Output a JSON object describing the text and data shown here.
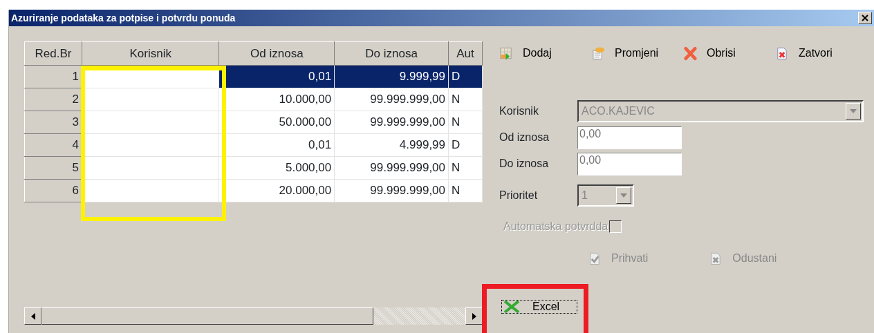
{
  "window": {
    "title": "Azuriranje podataka za potpise i potvrdu  ponuda"
  },
  "table": {
    "columns": [
      "Red.Br",
      "Korisnik",
      "Od iznosa",
      "Do iznosa",
      "Aut"
    ],
    "rows": [
      {
        "cells": [
          "1",
          "",
          "0,01",
          "9.999,99",
          "D"
        ],
        "selected": true
      },
      {
        "cells": [
          "2",
          "",
          "10.000,00",
          "99.999.999,00",
          "N"
        ],
        "selected": false
      },
      {
        "cells": [
          "3",
          "",
          "50.000,00",
          "99.999.999,00",
          "N"
        ],
        "selected": false
      },
      {
        "cells": [
          "4",
          "",
          "0,01",
          "4.999,99",
          "D"
        ],
        "selected": false
      },
      {
        "cells": [
          "5",
          "",
          "5.000,00",
          "99.999.999,00",
          "N"
        ],
        "selected": false
      },
      {
        "cells": [
          "6",
          "",
          "20.000,00",
          "99.999.999,00",
          "N"
        ],
        "selected": false
      }
    ]
  },
  "toolbar": [
    {
      "label": "Dodaj",
      "kind": "add"
    },
    {
      "label": "Promjeni",
      "kind": "edit"
    },
    {
      "label": "Obrisi",
      "kind": "delete"
    },
    {
      "label": "Zatvori",
      "kind": "close"
    }
  ],
  "form": {
    "fields": [
      {
        "label": "Korisnik",
        "kind": "combo",
        "value": "ACO.KAJEVIC",
        "disabled": true
      },
      {
        "label": "Od iznosa",
        "kind": "text",
        "value": "0,00",
        "disabled": false
      },
      {
        "label": "Do iznosa",
        "kind": "text",
        "value": "0,00",
        "disabled": false
      },
      {
        "label": "Prioritet",
        "kind": "small-combo",
        "value": "1",
        "disabled": true
      }
    ],
    "auto_confirm": {
      "label": "Automatska potvrdda",
      "checked": false,
      "disabled": true
    },
    "actions": [
      {
        "label": "Prihvati",
        "kind": "accept",
        "disabled": true
      },
      {
        "label": "Odustani",
        "kind": "cancel",
        "disabled": true
      }
    ]
  },
  "excel_button": {
    "label": "Excel"
  }
}
